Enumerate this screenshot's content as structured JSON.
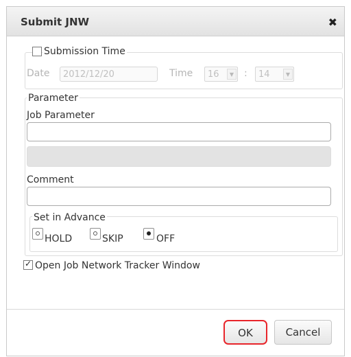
{
  "dialog": {
    "title": "Submit JNW",
    "close_glyph": "✖"
  },
  "submission_time": {
    "legend": "Submission Time",
    "checked": false,
    "date_label": "Date",
    "date_value": "2012/12/20",
    "time_label": "Time",
    "hour_value": "16",
    "time_separator": ":",
    "minute_value": "14"
  },
  "parameter": {
    "legend": "Parameter",
    "job_parameter_label": "Job Parameter",
    "job_parameter_value": "",
    "comment_label": "Comment",
    "comment_value": "",
    "set_in_advance": {
      "legend": "Set in Advance",
      "options": [
        {
          "label": "HOLD",
          "selected": false
        },
        {
          "label": "SKIP",
          "selected": false
        },
        {
          "label": "OFF",
          "selected": true
        }
      ]
    }
  },
  "open_tracker": {
    "label": "Open Job Network Tracker Window",
    "checked": true
  },
  "buttons": {
    "ok_label": "OK",
    "cancel_label": "Cancel"
  },
  "colors": {
    "highlight": "#e8242a"
  }
}
